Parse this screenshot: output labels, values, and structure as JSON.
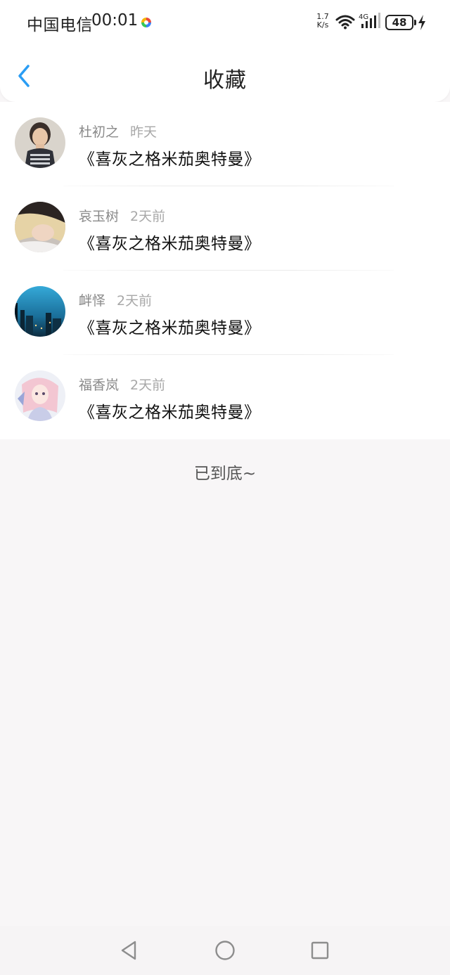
{
  "status_bar": {
    "carrier": "中国电信",
    "time": "00:01",
    "net_speed_value": "1.7",
    "net_speed_unit": "K/s",
    "network_type": "4G",
    "battery": "48",
    "icons": [
      "app-notification-icon",
      "wifi-icon",
      "signal-icon",
      "battery-icon",
      "charging-bolt-icon"
    ]
  },
  "nav": {
    "back_icon": "chevron-left-icon",
    "title": "收藏",
    "accent_color": "#2a9df4"
  },
  "favorites": [
    {
      "name": "杜初之",
      "time": "昨天",
      "title": "《喜灰之格米茄奥特曼》",
      "avatar": "avatar-photo-person"
    },
    {
      "name": "哀玉树",
      "time": "2天前",
      "title": "《喜灰之格米茄奥特曼》",
      "avatar": "avatar-photo-blonde"
    },
    {
      "name": "衅怿",
      "time": "2天前",
      "title": "《喜灰之格米茄奥特曼》",
      "avatar": "avatar-photo-city"
    },
    {
      "name": "福香岚",
      "time": "2天前",
      "title": "《喜灰之格米茄奥特曼》",
      "avatar": "avatar-photo-anime"
    }
  ],
  "footer": {
    "end_text": "已到底~"
  },
  "system_nav": {
    "icons": [
      "back-triangle-icon",
      "home-circle-icon",
      "recents-square-icon"
    ]
  }
}
